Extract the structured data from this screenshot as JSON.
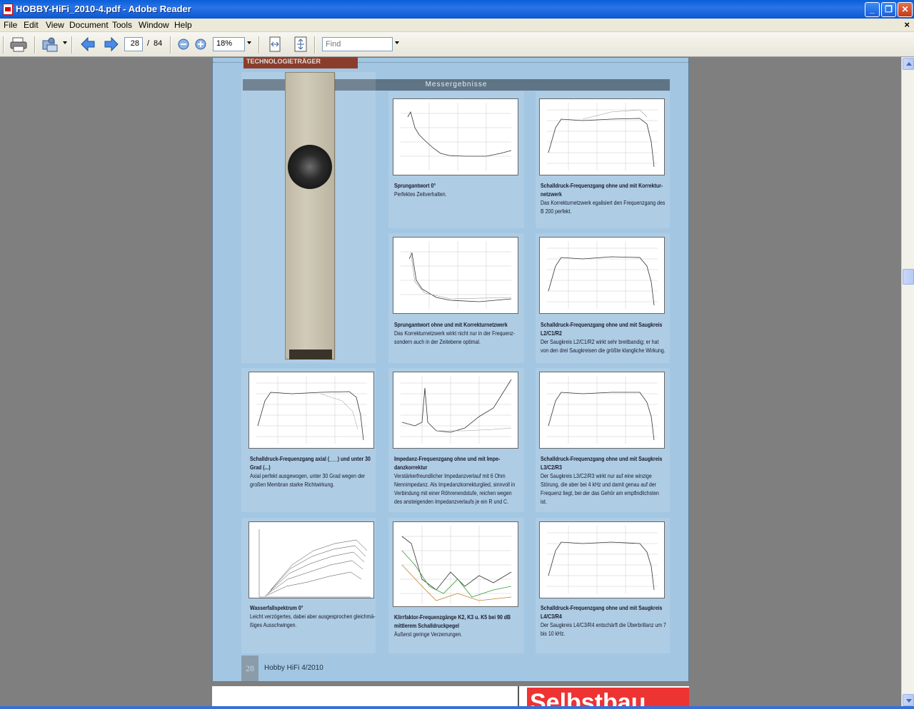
{
  "window": {
    "title": "HOBBY-HiFi_2010-4.pdf - Adobe Reader"
  },
  "menu": {
    "items": [
      "File",
      "Edit",
      "View",
      "Document",
      "Tools",
      "Window",
      "Help"
    ],
    "close": "×"
  },
  "toolbar": {
    "page_current": "28",
    "page_sep": "/",
    "page_total": "84",
    "zoom": "18%",
    "find_placeholder": "Find"
  },
  "page": {
    "tech_header": "TECHNOLOGIETRÄGER",
    "section_title": "Messergebnisse",
    "page_number": "28",
    "footer": "Hobby HiFi 4/2010",
    "next_page_title": "Selbstbau"
  },
  "figures": [
    {
      "title": "Sprungantwort 0°",
      "body": "Perfektes Zeitverhalten."
    },
    {
      "title": "Schalldruck-Frequenzgang ohne und mit Korrektur-netzwerk",
      "body": "Das Korrekturnetzwerk egalisiert den Frequenzgang des B 200 perfekt."
    },
    {
      "title": "Sprungantwort ohne und mit Korrekturnetzwerk",
      "body": "Das Korrekturnetzwerk wirkt nicht nur in der Frequenz- sondern auch in der Zeitebene optimal."
    },
    {
      "title": "Schalldruck-Frequenzgang ohne und mit Saugkreis L2/C1/R2",
      "body": "Der Saugkreis L2/C1/R2 wirkt sehr breitbandig; er hat von den drei Saugkreisen die größte klangliche Wirkung."
    },
    {
      "title": "Schalldruck-Frequenzgang axial (___) und unter 30 Grad (...)",
      "body": "Axial perfekt ausgewogen, unter 30 Grad wegen der großen Membran starke Richtwirkung."
    },
    {
      "title": "Impedanz-Frequenzgang ohne und mit Impe-danzkorrektur",
      "body": "Verstärkerfreundlicher Impedanzverlauf mit 6 Ohm Nennimpedanz. Als Impedanzkorrekturglied, sinnvoll in Verbindung mit einer Röhrenendstufe, reichen wegen des ansteigenden Impedanzverlaufs je ein R und C."
    },
    {
      "title": "Schalldruck-Frequenzgang ohne und mit Saugkreis L3/C2/R3",
      "body": "Der Saugkreis L3/C2/R3 wirkt nur auf eine winzige Störung, die aber bei 4 kHz und damit genau auf der Frequenz liegt, bei der das Gehör am empfindlichsten ist."
    },
    {
      "title": "Wasserfallspektrum 0°",
      "body": "Leicht verzögertes, dabei aber ausgesprochen gleichmä-ßiges Ausschwingen."
    },
    {
      "title": "Klirrfaktor-Frequenzgänge K2, K3 u. K5 bei 90 dB mittlerem Schalldruckpegel",
      "body": "Äußerst geringe Verzerrungen."
    },
    {
      "title": "Schalldruck-Frequenzgang ohne und mit Saugkreis L4/C3/R4",
      "body": "Der Saugkreis L4/C3/R4 entschärft die Überbrillanz um 7 bis 10 kHz."
    }
  ],
  "colors": {
    "page_bg": "#a3c6e2",
    "titlebar": "#0a5fd8",
    "header_red": "#8b3d2b",
    "next_page_red": "#e33333"
  }
}
